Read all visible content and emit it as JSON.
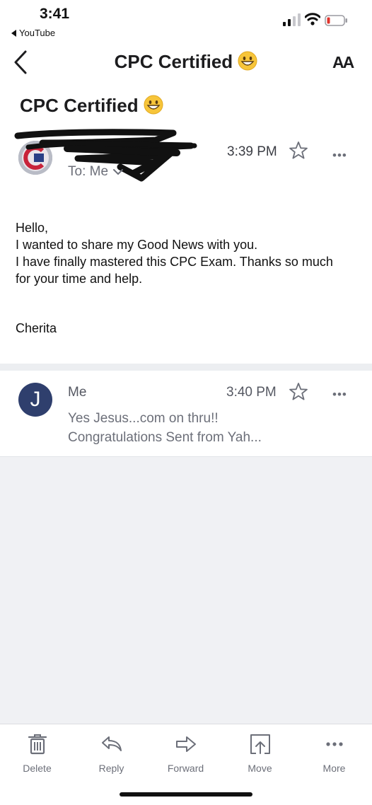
{
  "status_bar": {
    "time": "3:41",
    "back_app": "YouTube"
  },
  "nav": {
    "title": "CPC Certified",
    "text_size_label": "AA"
  },
  "subject": "CPC Certified",
  "message1": {
    "to_label": "To: Me",
    "time": "3:39 PM",
    "body_lines": [
      "Hello,",
      "I wanted to share my Good News with you.",
      "I have finally mastered this CPC Exam.  Thanks so much",
      "for your time and help."
    ],
    "signature": "Cherita"
  },
  "message2": {
    "avatar_letter": "J",
    "sender": "Me",
    "time": "3:40 PM",
    "snippet_line1": "Yes Jesus...com on thru!!",
    "snippet_line2": "Congratulations  Sent from Yah..."
  },
  "toolbar": {
    "delete": "Delete",
    "reply": "Reply",
    "forward": "Forward",
    "move": "Move",
    "more": "More"
  },
  "colors": {
    "accent": "#1d1d1f",
    "secondary_text": "#6c6f79",
    "divider": "#eceef1",
    "battery_low": "#e0342c",
    "avatar_j": "#2f3f6d"
  }
}
